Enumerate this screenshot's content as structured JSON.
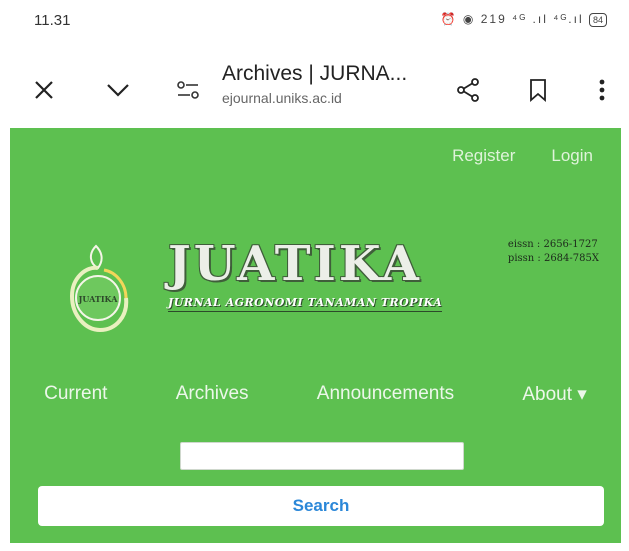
{
  "status_bar": {
    "time": "11.31",
    "indicators": "⏰ ◉ 219 ⁴ᴳ .ıl ⁴ᴳ.ıl",
    "battery": "84"
  },
  "browser": {
    "page_title": "Archives | JURNA...",
    "host": "ejournal.uniks.ac.id",
    "icons": [
      "close-icon",
      "chevron-down-icon",
      "site-settings-icon",
      "share-icon",
      "bookmark-icon",
      "more-vert-icon"
    ]
  },
  "site": {
    "bg_color": "#5dc050",
    "top_links": {
      "register": "Register",
      "login": "Login"
    },
    "brand": {
      "title": "JUATIKA",
      "subtitle": "JURNAL AGRONOMI TANAMAN TROPIKA",
      "logo_text": "JUATIKA",
      "issn_e": "eissn : 2656-1727",
      "issn_p": "pissn : 2684-785X"
    },
    "nav": {
      "current": "Current",
      "archives": "Archives",
      "announcements": "Announcements",
      "about": "About ▾"
    },
    "search": {
      "input_value": "",
      "button": "Search"
    }
  }
}
